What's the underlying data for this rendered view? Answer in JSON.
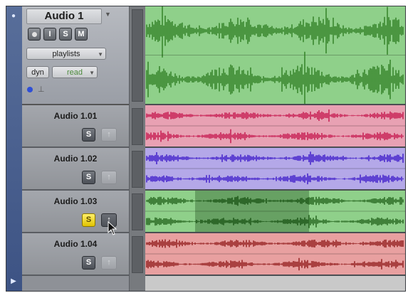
{
  "main_track": {
    "name": "Audio 1",
    "buttons": {
      "rec": "",
      "input": "I",
      "solo": "S",
      "mute": "M"
    },
    "playlists_label": "playlists",
    "view_label": "dyn",
    "automation_label": "read",
    "color": "#8fd08a",
    "waveform_color": "#2e7d22"
  },
  "sub_tracks": [
    {
      "name": "Audio 1.01",
      "solo_label": "S",
      "up_label": "↑",
      "solo_on": false,
      "color": "#e8a1b3",
      "waveform_color": "#c4124a"
    },
    {
      "name": "Audio 1.02",
      "solo_label": "S",
      "up_label": "↑",
      "solo_on": false,
      "color": "#b4a8e8",
      "waveform_color": "#3a16c8"
    },
    {
      "name": "Audio 1.03",
      "solo_label": "S",
      "up_label": "↑",
      "solo_on": true,
      "color": "#8fd08a",
      "waveform_color": "#1e5f17"
    },
    {
      "name": "Audio 1.04",
      "solo_label": "S",
      "up_label": "↑",
      "solo_on": false,
      "color": "#e8a0a0",
      "waveform_color": "#8e1717"
    }
  ],
  "icons": {
    "gutter_top": "circle-arrow-icon",
    "gutter_bottom": "triangle-right-icon",
    "cursor": "pointer-cursor-icon"
  },
  "colors": {
    "gutter": "#4a6193",
    "header": "#9a9ea6",
    "selection": "dark-overlay"
  }
}
